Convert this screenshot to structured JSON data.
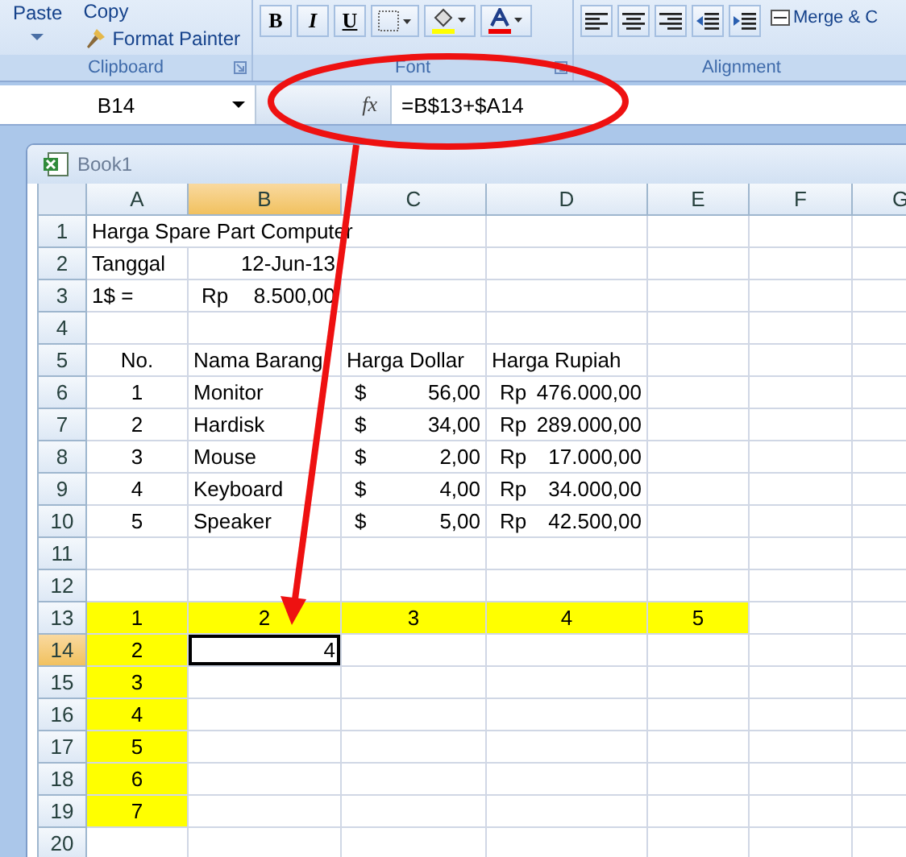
{
  "ribbon": {
    "clipboard": {
      "paste": "Paste",
      "copy": "Copy",
      "format_painter": "Format Painter",
      "label": "Clipboard"
    },
    "font": {
      "bold": "B",
      "italic": "I",
      "underline": "U",
      "label": "Font"
    },
    "alignment": {
      "merge": "Merge & C",
      "label": "Alignment"
    }
  },
  "formula_bar": {
    "name_box": "B14",
    "function_label": "fx",
    "formula": "=B$13+$A14"
  },
  "workbook": {
    "title": "Book1"
  },
  "columns": [
    {
      "label": "A",
      "selected": false
    },
    {
      "label": "B",
      "selected": true
    },
    {
      "label": "C",
      "selected": false
    },
    {
      "label": "D",
      "selected": false
    },
    {
      "label": "E",
      "selected": false
    },
    {
      "label": "F",
      "selected": false
    },
    {
      "label": "G",
      "selected": false
    }
  ],
  "rows": [
    {
      "label": "1",
      "selected": false,
      "cells": [
        {
          "kind": "title",
          "text": "Harga Spare Part Computer",
          "highlighted": false,
          "selected": false
        }
      ]
    },
    {
      "label": "2",
      "selected": false,
      "cells": [
        {
          "kind": "label",
          "text": "Tanggal",
          "highlighted": false,
          "selected": false
        },
        {
          "kind": "value",
          "text": "12-Jun-13",
          "highlighted": false,
          "selected": false
        }
      ]
    },
    {
      "label": "3",
      "selected": false,
      "cells": [
        {
          "kind": "label",
          "text": "1$ =",
          "highlighted": false,
          "selected": false
        },
        {
          "kind": "currency",
          "prefix": "Rp",
          "text": "8.500,00",
          "highlighted": false,
          "selected": false
        }
      ]
    },
    {
      "label": "4",
      "selected": false,
      "cells": []
    },
    {
      "label": "5",
      "selected": false,
      "cells": [
        {
          "kind": "centered",
          "text": "No.",
          "highlighted": false,
          "selected": false
        },
        {
          "kind": "label",
          "text": "Nama Barang",
          "highlighted": false,
          "selected": false
        },
        {
          "kind": "label",
          "text": "Harga Dollar",
          "highlighted": false,
          "selected": false
        },
        {
          "kind": "label",
          "text": "Harga Rupiah",
          "highlighted": false,
          "selected": false
        }
      ]
    },
    {
      "label": "6",
      "selected": false,
      "cells": [
        {
          "kind": "centered",
          "text": "1",
          "highlighted": false,
          "selected": false
        },
        {
          "kind": "label",
          "text": "Monitor",
          "highlighted": false,
          "selected": false
        },
        {
          "kind": "currency",
          "prefix": "$",
          "text": "56,00",
          "highlighted": false,
          "selected": false
        },
        {
          "kind": "currency",
          "prefix": "Rp",
          "text": "476.000,00",
          "highlighted": false,
          "selected": false
        }
      ]
    },
    {
      "label": "7",
      "selected": false,
      "cells": [
        {
          "kind": "centered",
          "text": "2",
          "highlighted": false,
          "selected": false
        },
        {
          "kind": "label",
          "text": "Hardisk",
          "highlighted": false,
          "selected": false
        },
        {
          "kind": "currency",
          "prefix": "$",
          "text": "34,00",
          "highlighted": false,
          "selected": false
        },
        {
          "kind": "currency",
          "prefix": "Rp",
          "text": "289.000,00",
          "highlighted": false,
          "selected": false
        }
      ]
    },
    {
      "label": "8",
      "selected": false,
      "cells": [
        {
          "kind": "centered",
          "text": "3",
          "highlighted": false,
          "selected": false
        },
        {
          "kind": "label",
          "text": "Mouse",
          "highlighted": false,
          "selected": false
        },
        {
          "kind": "currency",
          "prefix": "$",
          "text": "2,00",
          "highlighted": false,
          "selected": false
        },
        {
          "kind": "currency",
          "prefix": "Rp",
          "text": "17.000,00",
          "highlighted": false,
          "selected": false
        }
      ]
    },
    {
      "label": "9",
      "selected": false,
      "cells": [
        {
          "kind": "centered",
          "text": "4",
          "highlighted": false,
          "selected": false
        },
        {
          "kind": "label",
          "text": "Keyboard",
          "highlighted": false,
          "selected": false
        },
        {
          "kind": "currency",
          "prefix": "$",
          "text": "4,00",
          "highlighted": false,
          "selected": false
        },
        {
          "kind": "currency",
          "prefix": "Rp",
          "text": "34.000,00",
          "highlighted": false,
          "selected": false
        }
      ]
    },
    {
      "label": "10",
      "selected": false,
      "cells": [
        {
          "kind": "centered",
          "text": "5",
          "highlighted": false,
          "selected": false
        },
        {
          "kind": "label",
          "text": "Speaker",
          "highlighted": false,
          "selected": false
        },
        {
          "kind": "currency",
          "prefix": "$",
          "text": "5,00",
          "highlighted": false,
          "selected": false
        },
        {
          "kind": "currency",
          "prefix": "Rp",
          "text": "42.500,00",
          "highlighted": false,
          "selected": false
        }
      ]
    },
    {
      "label": "11",
      "selected": false,
      "cells": []
    },
    {
      "label": "12",
      "selected": false,
      "cells": []
    },
    {
      "label": "13",
      "selected": false,
      "cells": [
        {
          "kind": "centered",
          "text": "1",
          "highlighted": true,
          "selected": false
        },
        {
          "kind": "centered",
          "text": "2",
          "highlighted": true,
          "selected": false
        },
        {
          "kind": "centered",
          "text": "3",
          "highlighted": true,
          "selected": false
        },
        {
          "kind": "centered",
          "text": "4",
          "highlighted": true,
          "selected": false
        },
        {
          "kind": "centered",
          "text": "5",
          "highlighted": true,
          "selected": false
        }
      ]
    },
    {
      "label": "14",
      "selected": true,
      "cells": [
        {
          "kind": "centered",
          "text": "2",
          "highlighted": true,
          "selected": false
        },
        {
          "kind": "value",
          "text": "4",
          "highlighted": false,
          "selected": true
        }
      ]
    },
    {
      "label": "15",
      "selected": false,
      "cells": [
        {
          "kind": "centered",
          "text": "3",
          "highlighted": true,
          "selected": false
        }
      ]
    },
    {
      "label": "16",
      "selected": false,
      "cells": [
        {
          "kind": "centered",
          "text": "4",
          "highlighted": true,
          "selected": false
        }
      ]
    },
    {
      "label": "17",
      "selected": false,
      "cells": [
        {
          "kind": "centered",
          "text": "5",
          "highlighted": true,
          "selected": false
        }
      ]
    },
    {
      "label": "18",
      "selected": false,
      "cells": [
        {
          "kind": "centered",
          "text": "6",
          "highlighted": true,
          "selected": false
        }
      ]
    },
    {
      "label": "19",
      "selected": false,
      "cells": [
        {
          "kind": "centered",
          "text": "7",
          "highlighted": true,
          "selected": false
        }
      ]
    },
    {
      "label": "20",
      "selected": false,
      "cells": []
    }
  ]
}
